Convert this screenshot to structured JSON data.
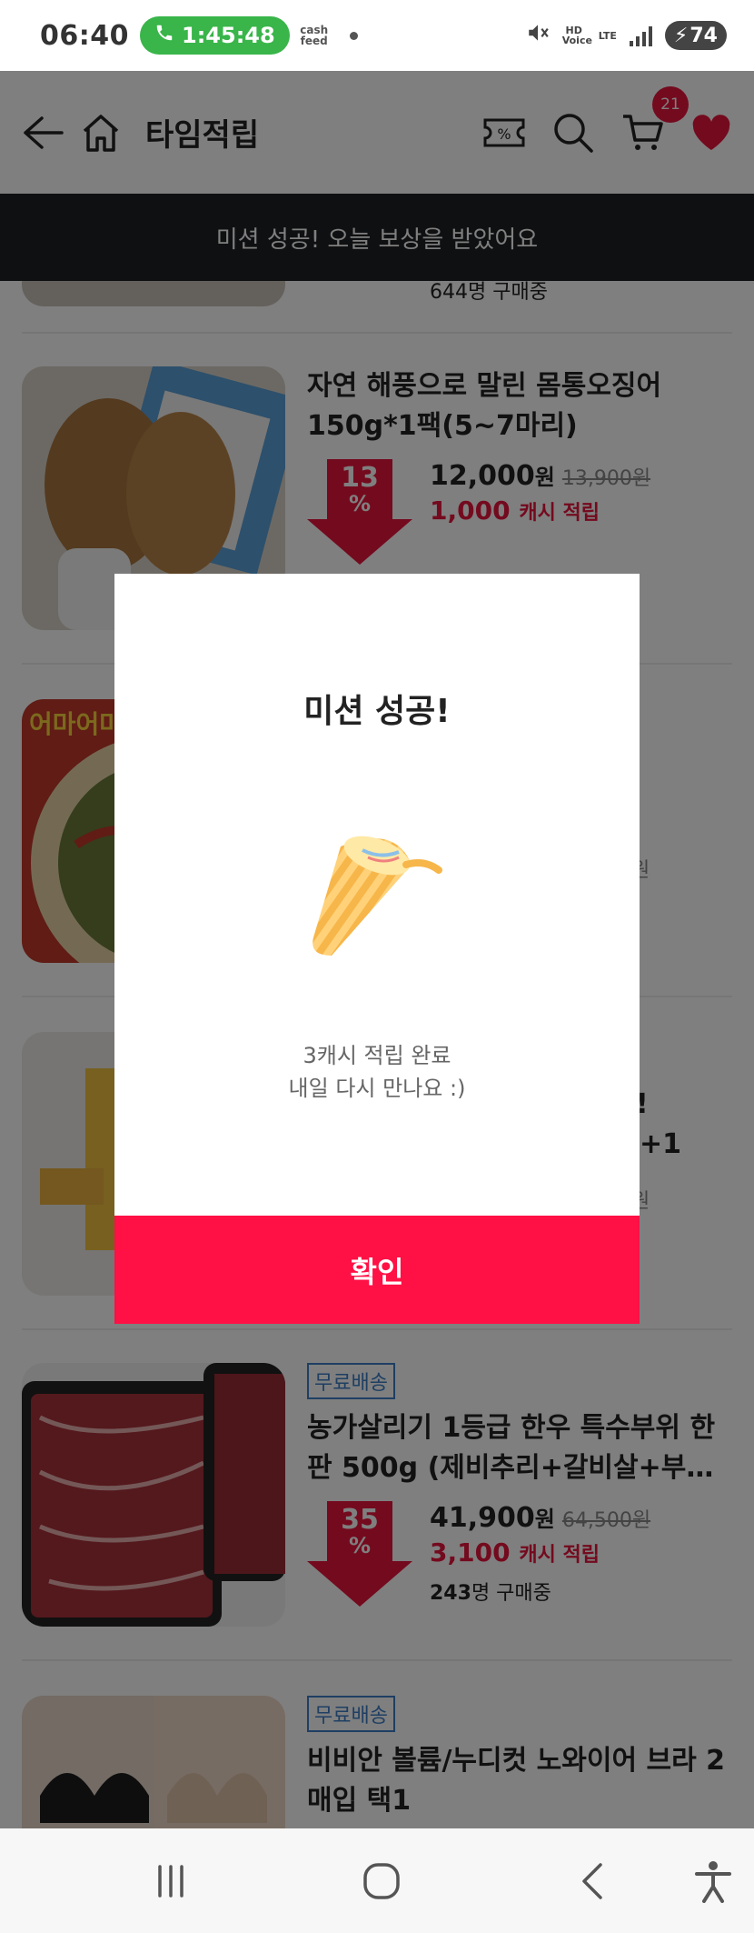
{
  "status_bar": {
    "time": "06:40",
    "call_timer": "1:45:48",
    "cashfeed_label": "cash feed",
    "hd_label": "HD Voice",
    "lte_label": "LTE",
    "battery": "74"
  },
  "header": {
    "title": "타임적립",
    "cart_count": "21"
  },
  "banner": {
    "text": "미션 성공! 오늘 보상을 받았어요"
  },
  "products": [
    {
      "partial_buyers": "644명 구매중"
    },
    {
      "free_shipping": "",
      "title": "자연 해풍으로 말린 몸통오징어 150g*1팩(5~7마리)",
      "discount": "13",
      "price": "12,000",
      "price_unit": "원",
      "original_price": "13,900원",
      "cash": "1,000",
      "cash_label": "캐시 적립",
      "buyers_count": "",
      "buyers_label": ""
    },
    {
      "free_shipping": "무료배송",
      "title": "농가살리기 1등급 한우 특수부위 한판 500g (제비추리+갈비살+부…",
      "discount": "35",
      "price": "41,900",
      "price_unit": "원",
      "original_price": "64,500원",
      "cash": "3,100",
      "cash_label": "캐시 적립",
      "buyers_count": "243",
      "buyers_label": "명 구매중"
    },
    {
      "free_shipping": "무료배송",
      "title": "비비안 볼륨/누디컷 노와이어 브라 2매입 택1"
    }
  ],
  "partial_labels": {
    "item3_img_text": "어마어마",
    "item3_frag": "원",
    "item4_frag1": "!",
    "item4_frag2": "+1",
    "item4_frag3": "원"
  },
  "modal": {
    "title": "미션 성공!",
    "message_line1": "3캐시 적립 완료",
    "message_line2": "내일 다시 만나요 :)",
    "confirm_label": "확인"
  },
  "colors": {
    "accent": "#ff1045",
    "cash_red": "#e8143c",
    "free_shipping_blue": "#3f7ec7",
    "call_green": "#39b54a",
    "banner_bg": "#1f2022"
  }
}
